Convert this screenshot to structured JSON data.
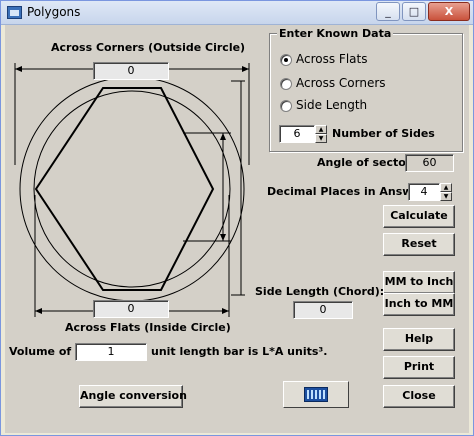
{
  "window": {
    "title": "Polygons",
    "controls": {
      "minimize": "_",
      "maximize": "□",
      "close": "X"
    }
  },
  "diagram": {
    "corners_label": "Across Corners (Outside Circle)",
    "corners_value": "0",
    "flats_label": "Across Flats (Inside Circle)",
    "flats_value": "0"
  },
  "known_data": {
    "title": "Enter Known Data",
    "options": [
      {
        "label": "Across Flats",
        "selected": true
      },
      {
        "label": "Across Corners",
        "selected": false
      },
      {
        "label": "Side Length",
        "selected": false
      }
    ],
    "sides_value": "6",
    "sides_label": "Number of Sides"
  },
  "sector": {
    "label": "Angle of sector:",
    "value": "60"
  },
  "decimals": {
    "label": "Decimal Places in Answer",
    "value": "4"
  },
  "side_length": {
    "label": "Side Length (Chord):",
    "value": "0"
  },
  "volume": {
    "prefix": "Volume of a",
    "value": "1",
    "suffix": "unit length bar is L*A units³."
  },
  "buttons": {
    "calculate": "Calculate",
    "reset": "Reset",
    "mm_to_inch": "MM to Inch",
    "inch_to_mm": "Inch to MM",
    "help": "Help",
    "print": "Print",
    "close": "Close",
    "angle_conversion": "Angle conversion"
  },
  "icons": {
    "app": "polygon-app-icon",
    "calculator": "calculator-icon"
  }
}
